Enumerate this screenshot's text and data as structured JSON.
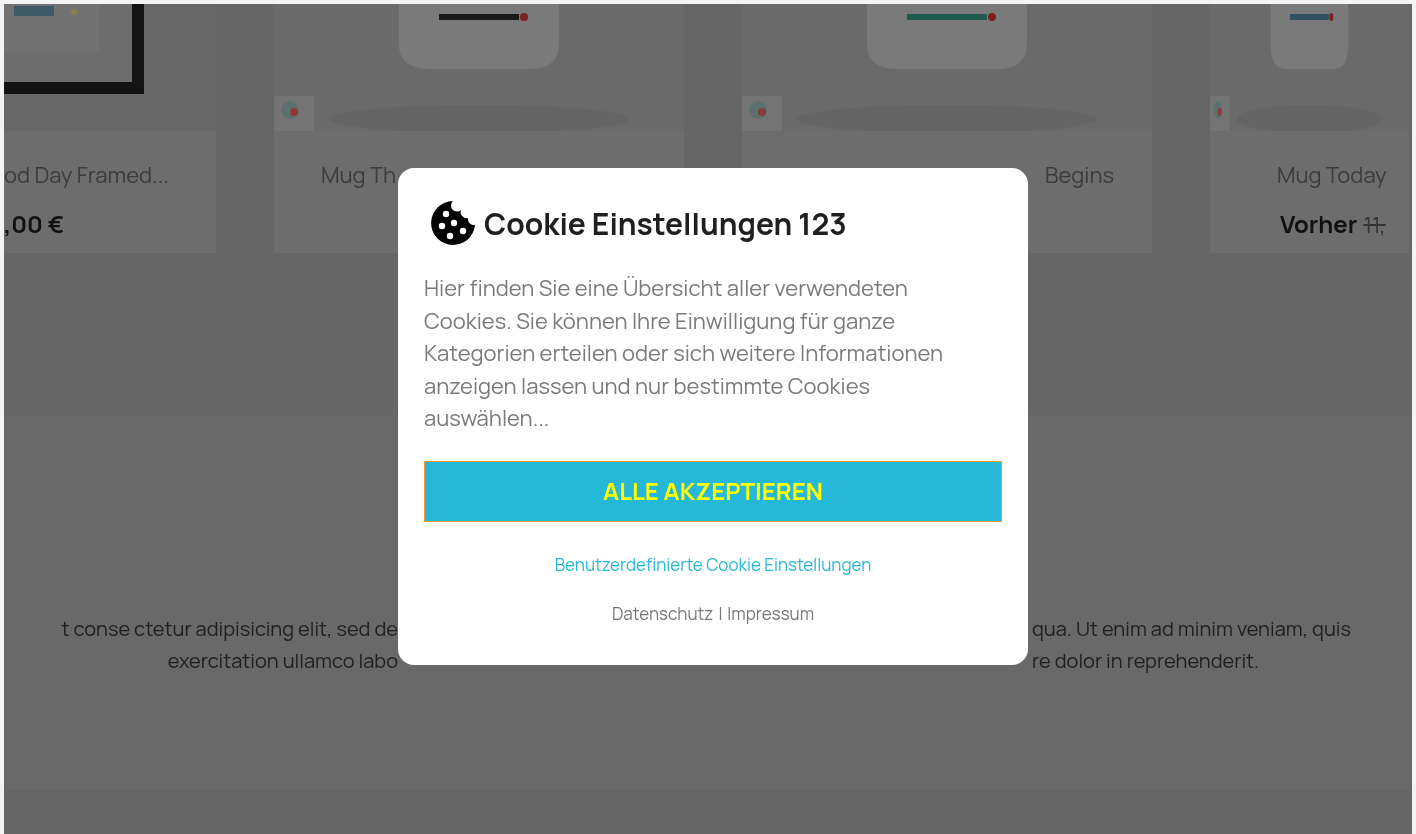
{
  "products": [
    {
      "title": "od Day Framed...",
      "price": ",00 €"
    },
    {
      "title": "Mug Th"
    },
    {
      "title": "Begins"
    },
    {
      "title": "Mug Today",
      "price_label": "Vorher",
      "old_price": "11,"
    }
  ],
  "description_lines": [
    {
      "left": "t conse ctetur adipisicing elit, sed de",
      "right": "qua. Ut enim ad minim veniam, quis"
    },
    {
      "left": "exercitation ullamco labo",
      "right": "re dolor in reprehenderit."
    }
  ],
  "cookie_dialog": {
    "title": "Cookie Einstellungen 123",
    "text": "Hier finden Sie eine Übersicht aller verwendeten Cookies. Sie können Ihre Einwilligung für ganze Kategorien erteilen oder sich weitere Informationen anzeigen lassen und nur bestimmte Cookies auswählen...",
    "accept_button": "ALLE AKZEPTIEREN",
    "custom_link": "Benutzerdefinierte Cookie Einstellungen",
    "footer_links": [
      "Datenschutz",
      "Impressum"
    ],
    "footer_separator": "I"
  }
}
